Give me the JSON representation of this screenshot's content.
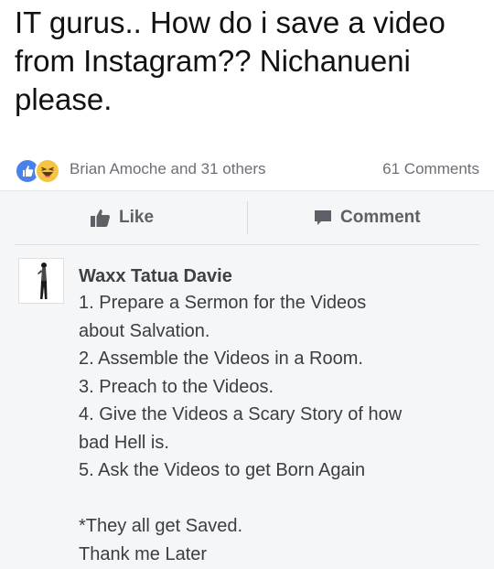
{
  "post": {
    "text": "IT gurus.. How do i save a video from Instagram?? Nichanueni please."
  },
  "reactions": {
    "names": "Brian Amoche and 31 others",
    "comments_count": "61 Comments",
    "icons": [
      "like-icon",
      "haha-icon"
    ],
    "like_color": "#4a80e8",
    "haha_color": "#f5c443"
  },
  "actions": {
    "like_label": "Like",
    "comment_label": "Comment",
    "icons": [
      "thumbs-up-icon",
      "speech-bubble-icon"
    ]
  },
  "comment": {
    "author": "Waxx Tatua Davie",
    "lines": [
      "1. Prepare a Sermon for the Videos",
      "about Salvation.",
      "2. Assemble the Videos in a Room.",
      "3. Preach to the Videos.",
      "4. Give the Videos a Scary Story of how",
      "bad Hell is.",
      "5. Ask the Videos to get Born Again",
      "",
      "*They all get Saved.",
      "Thank me Later"
    ]
  }
}
